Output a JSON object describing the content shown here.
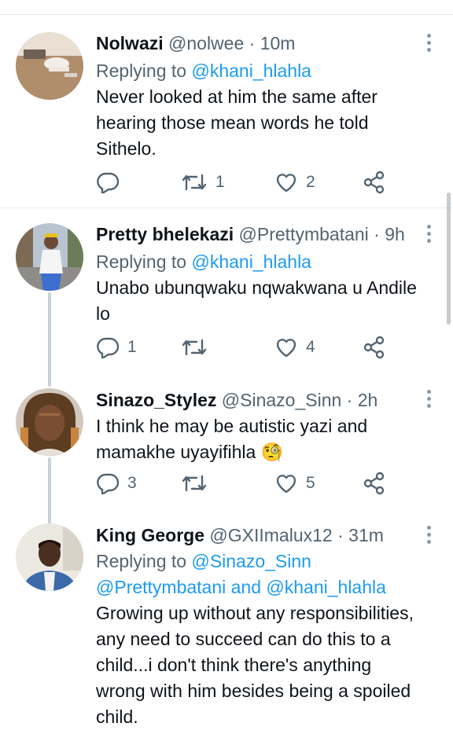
{
  "tweets": [
    {
      "name": "Nolwazi",
      "handle": "@nolwee",
      "time": "10m",
      "replying_prefix": "Replying to ",
      "replying_to": "@khani_hlahla",
      "lines": [
        "Never looked at him the same after",
        "hearing those mean words he told",
        "Sithelo."
      ],
      "reply_count": "",
      "retweet_count": "1",
      "like_count": "2"
    },
    {
      "name": "Pretty bhelekazi",
      "handle": "@Prettymbatani",
      "time": "9h",
      "replying_prefix": "Replying to ",
      "replying_to": "@khani_hlahla",
      "lines": [
        "Unabo ubunqwaku nqwakwana u Andile",
        "lo"
      ],
      "reply_count": "1",
      "retweet_count": "",
      "like_count": "4"
    },
    {
      "name": "Sinazo_Stylez",
      "handle": "@Sinazo_Sinn",
      "time": "2h",
      "lines": [
        "I think he may be autistic yazi and",
        "mamakhe uyayifihla"
      ],
      "emoji": "🧐",
      "reply_count": "3",
      "retweet_count": "",
      "like_count": "5"
    },
    {
      "name": "King George",
      "handle": "@GXIImalux12",
      "time": "31m",
      "replying_prefix": "Replying to ",
      "replying_to": "@Sinazo_Sinn",
      "replying_line2_a": "@Prettymbatani",
      "replying_and": " and ",
      "replying_line2_b": "@khani_hlahla",
      "lines": [
        "Growing up without any responsibilities,",
        "any need to succeed can do this to a",
        "child...i don't think there's anything",
        "wrong with him besides being a spoiled",
        "child."
      ]
    }
  ],
  "separator": " · ",
  "colors": {
    "link": "#1d9bf0",
    "muted": "#536471",
    "text": "#0f1419",
    "divider": "#e6ecf0"
  },
  "icons": [
    "reply-icon",
    "retweet-icon",
    "like-icon",
    "share-icon",
    "more-icon"
  ]
}
